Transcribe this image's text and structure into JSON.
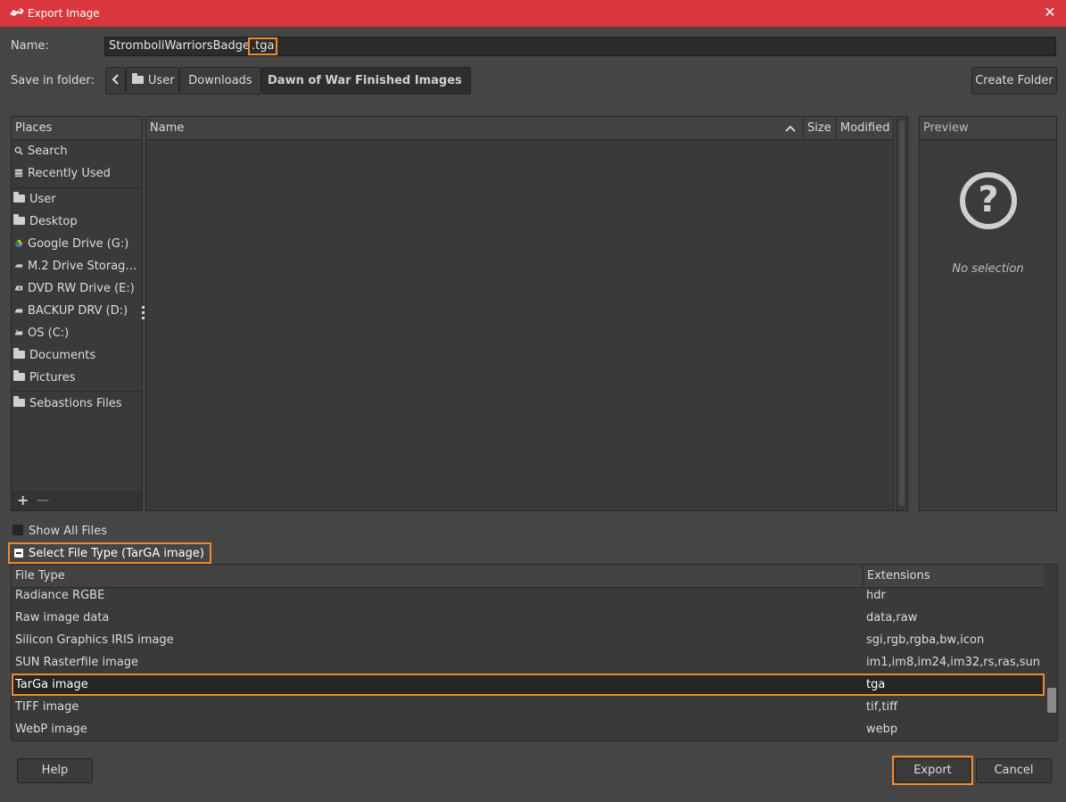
{
  "window": {
    "title": "Export Image",
    "close_label": "✕"
  },
  "name_row": {
    "label": "Name:",
    "filename_base": "StromboliWarriorsBadge",
    "filename_ext": ".tga"
  },
  "folder_row": {
    "label": "Save in folder:",
    "back_label": "<",
    "crumbs": [
      "User",
      "Downloads",
      "Dawn of War Finished Images"
    ],
    "create_folder_label": "Create Folder"
  },
  "places": {
    "header": "Places",
    "items": [
      {
        "label": "Search",
        "icon": "search-icon"
      },
      {
        "label": "Recently Used",
        "icon": "recent-icon"
      },
      {
        "label": "User",
        "icon": "folder-icon"
      },
      {
        "label": "Desktop",
        "icon": "folder-icon"
      },
      {
        "label": "Google Drive (G:)",
        "icon": "google-drive-icon"
      },
      {
        "label": "M.2 Drive Storag…",
        "icon": "drive-icon"
      },
      {
        "label": "DVD RW Drive (E:)",
        "icon": "optical-drive-icon"
      },
      {
        "label": "BACKUP DRV (D:)",
        "icon": "drive-icon"
      },
      {
        "label": "OS (C:)",
        "icon": "system-drive-icon"
      },
      {
        "label": "Documents",
        "icon": "folder-icon"
      },
      {
        "label": "Pictures",
        "icon": "folder-icon"
      },
      {
        "label": "Sebastions Files",
        "icon": "folder-icon"
      }
    ],
    "add_label": "+",
    "remove_label": "—"
  },
  "files": {
    "columns": [
      "Name",
      "Size",
      "Modified"
    ]
  },
  "preview": {
    "header": "Preview",
    "empty_text": "No selection"
  },
  "options": {
    "show_all_files": "Show All Files",
    "select_file_type": "Select File Type (TarGA image)"
  },
  "file_types": {
    "columns": [
      "File Type",
      "Extensions"
    ],
    "rows": [
      {
        "type": "Radiance RGBE",
        "ext": "hdr"
      },
      {
        "type": "Raw image data",
        "ext": "data,raw"
      },
      {
        "type": "Silicon Graphics IRIS image",
        "ext": "sgi,rgb,rgba,bw,icon"
      },
      {
        "type": "SUN Rasterfile image",
        "ext": "im1,im8,im24,im32,rs,ras,sun"
      },
      {
        "type": "TarGa image",
        "ext": "tga"
      },
      {
        "type": "TIFF image",
        "ext": "tif,tiff"
      },
      {
        "type": "WebP image",
        "ext": "webp"
      }
    ],
    "selected_index": 4
  },
  "buttons": {
    "help": "Help",
    "export": "Export",
    "cancel": "Cancel"
  },
  "colors": {
    "titlebar": "#d9363e",
    "highlight": "#f08a2b"
  }
}
